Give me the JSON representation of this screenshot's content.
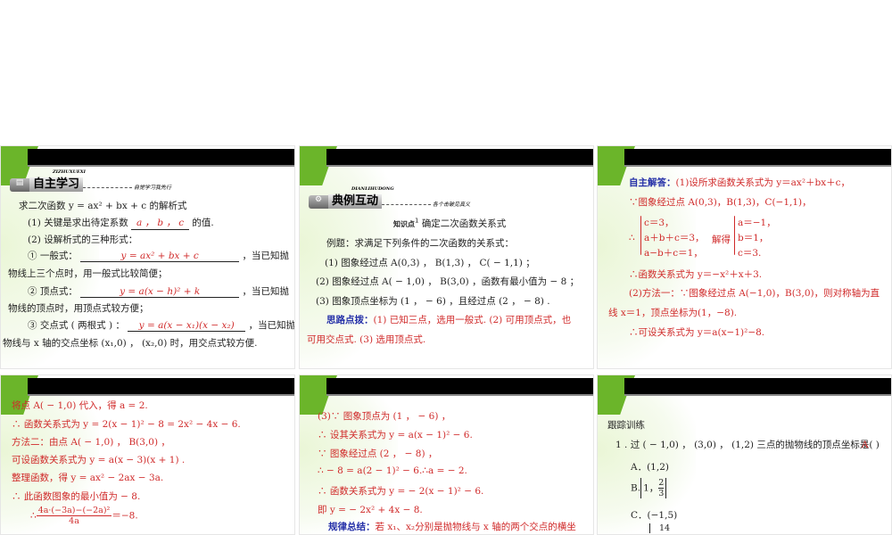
{
  "slide1": {
    "logo_pinyin": "ZIZHUXUEXI",
    "logo_title": "自主学习",
    "logo_tag": "自觉学习我先行",
    "intro": "求二次函数  y = ax² + bx + c 的解析式",
    "l1a": "(1) 关键是求出待定系数",
    "l1b": "a ， b ， c",
    "l1c": "的值.",
    "l2": "(2) 设解析式的三种形式：",
    "f1a": "① 一般式：",
    "f1b": "y = ax² + bx + c",
    "f1c": "，当已知抛",
    "f1d": "物线上三个点时，用一般式比较简便；",
    "f2a": "② 顶点式：",
    "f2b": "y = a(x − h)² + k",
    "f2c": "，当已知抛",
    "f2d": "物线的顶点时，用顶点式较方便；",
    "f3a": "③ 交点式 ( 两根式 ) ：",
    "f3b": "y = a(x − x₁)(x − x₂)",
    "f3c": "，当已知抛",
    "f3d": "物线与  x  轴的交点坐标 (x₁,0) ， (x₂,0) 时，用交点式较方便."
  },
  "slide2": {
    "logo_pinyin": "DIANLIHUDONG",
    "logo_title": "典例互动",
    "logo_tag": "各个击破见真义",
    "kp_label": "知识点",
    "kp_num": "1",
    "kp_title": "确定二次函数关系式",
    "ex": "例题：求满足下列条件的二次函数的关系式：",
    "c1": "(1) 图象经过点  A(0,3) ，  B(1,3) ，  C( − 1,1) ；",
    "c2": "(2) 图象经过点  A( − 1,0) ，  B(3,0) ，函数有最小值为 − 8 ；",
    "c3": "(3) 图象顶点坐标为 (1 ， − 6) ，且经过点 (2 ， − 8) .",
    "hint_label": "思路点拨：",
    "hint1": "(1) 已知三点，选用一般式.  (2) 可用顶点式，也",
    "hint2": "可用交点式.  (3) 选用顶点式."
  },
  "slide3": {
    "ans_label": "自主解答：",
    "a1": "(1)设所求函数关系式为 y＝ax²＋bx＋c，",
    "a2": "∵图象经过点 A(0,3)，B(1,3)，C(−1,1)，",
    "therefore": "∴",
    "sys1": [
      "c＝3，",
      "a＋b＋c＝3，",
      "a−b＋c＝1，"
    ],
    "solve": "解得",
    "sys2": [
      "a＝−1，",
      "b＝1，",
      "c＝3."
    ],
    "a3": "∴函数关系式为 y＝−x²＋x＋3.",
    "a4": "(2)方法一：∵图象经过点 A(−1,0)，B(3,0)，则对称轴为直",
    "a5": "线 x＝1，顶点坐标为(1，−8).",
    "a6": "∴可设关系式为 y＝a(x−1)²−8."
  },
  "slide4": {
    "lines": [
      "将点  A( − 1,0) 代入，得   a = 2.",
      "∴ 函数关系式为   y = 2(x − 1)² − 8 = 2x² − 4x − 6.",
      "方法二：由点   A( − 1,0) ，  B(3,0) ，",
      "可设函数关系式为   y = a(x − 3)(x + 1) .",
      "整理函数，得   y = ax² − 2ax − 3a.",
      "∴ 此函数图象的最小值为 − 8."
    ],
    "frac_pre": "∴",
    "frac_num": "4a·(−3a)−(−2a)²",
    "frac_den": "4a",
    "frac_post": "＝−8."
  },
  "slide5": {
    "lines": [
      "(3)∵ 图象顶点为 (1 ， − 6) ，",
      "∴ 设其关系式为   y = a(x − 1)² − 6.",
      "∵ 图象经过点 (2 ， − 8) ，",
      "∴ − 8 = a(2 − 1)² − 6.∴a = − 2.",
      "∴ 函数关系式为   y = − 2(x − 1)² − 6.",
      "即   y = − 2x² + 4x − 8."
    ],
    "rule_label": "规律总结：",
    "rule_text": "若 x₁、x₂分别是抛物线与 x 轴的两个交点的横坐"
  },
  "slide6": {
    "heading": "跟踪训练",
    "q1": "1 .  过 ( − 1,0) ，  (3,0) ，  (1,2) 三点的抛物线的顶点坐标是(   )",
    "answer_mark": "A",
    "optA": "A．(1,2)",
    "optB_pre": "B.",
    "optB_a": "1，",
    "optB_num": "2",
    "optB_den": "3",
    "optC": "C．(−1,5)",
    "optD_num": "14"
  },
  "colors": {
    "red": "#d02a2a",
    "blue": "#2530a8",
    "green": "#6bb52a"
  }
}
